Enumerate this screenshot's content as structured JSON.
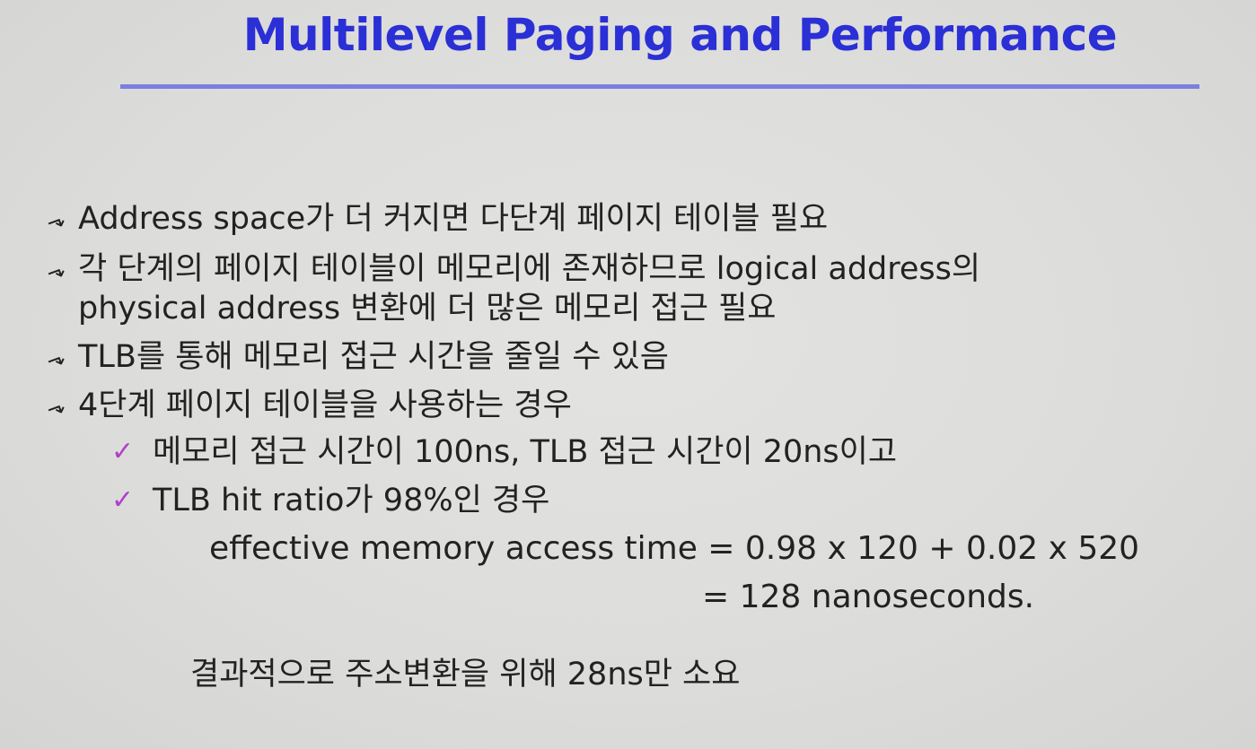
{
  "slide": {
    "title": "Multilevel Paging and Performance",
    "bullet_glyph": "⯆",
    "check_glyph": "✓",
    "bullets": [
      "Address space가 더 커지면 다단계 페이지 테이블 필요",
      "각 단계의 페이지 테이블이 메모리에 존재하므로 logical address의",
      "physical address 변환에 더 많은 메모리 접근 필요",
      "TLB를 통해 메모리 접근 시간을 줄일 수 있음",
      "4단계 페이지 테이블을 사용하는 경우"
    ],
    "sub_bullets": [
      "메모리 접근 시간이 100ns, TLB 접근 시간이 20ns이고",
      "TLB hit ratio가  98%인 경우"
    ],
    "formula_line1": "effective memory access time = 0.98 x 120 + 0.02 x 520",
    "formula_line2": "= 128 nanoseconds.",
    "conclusion": "결과적으로 주소변환을 위해 28ns만 소요"
  },
  "colors": {
    "title": "#2b2fd6",
    "rule": "#7a7fe0",
    "checkmark": "#b040c8",
    "background": "#dededc",
    "text": "#222222"
  }
}
